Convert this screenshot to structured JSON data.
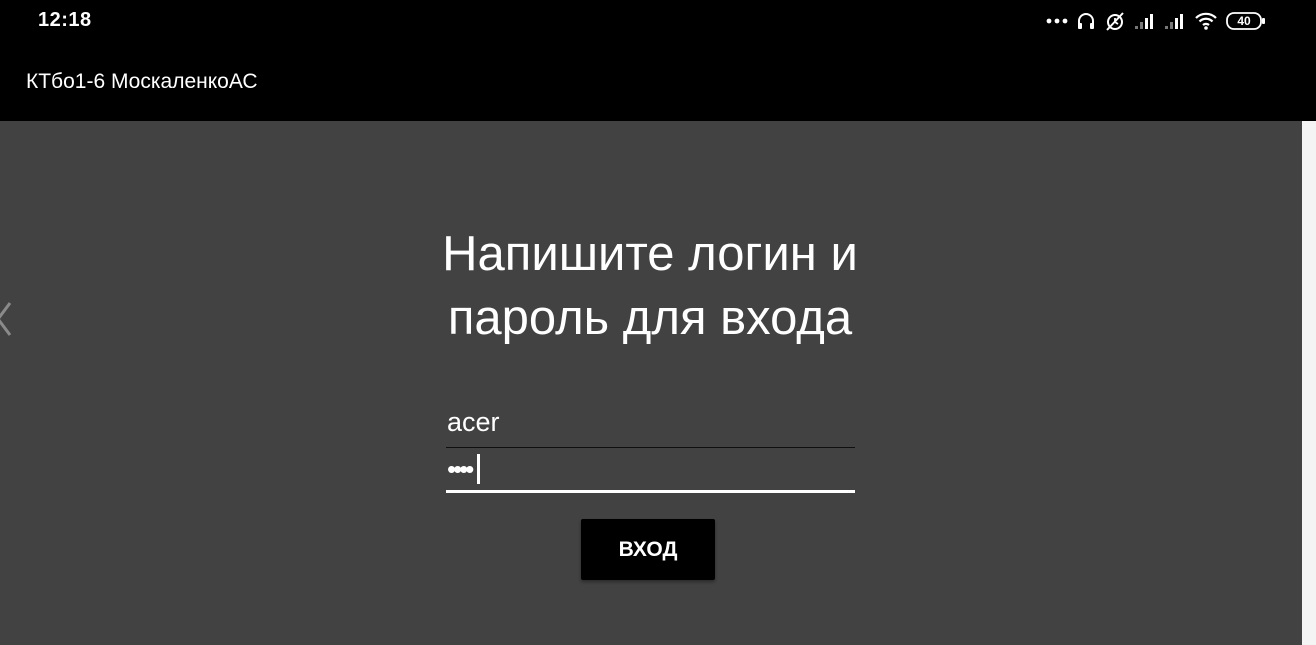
{
  "status_bar": {
    "time": "12:18",
    "battery": "40",
    "icons": [
      "more-dots-icon",
      "headphones-icon",
      "alarm-off-icon",
      "signal-1-icon",
      "signal-2-icon",
      "wifi-icon",
      "battery-icon"
    ]
  },
  "app_bar": {
    "title": "КТбо1-6 МоскаленкоАС"
  },
  "login_screen": {
    "prompt_line1": "Напишите логин и",
    "prompt_line2": "пароль для входа",
    "login_value": "acer",
    "password_value": "••••",
    "button_label": "вход"
  },
  "colors": {
    "background": "#424242",
    "bars": "#000000",
    "text": "#ffffff"
  }
}
